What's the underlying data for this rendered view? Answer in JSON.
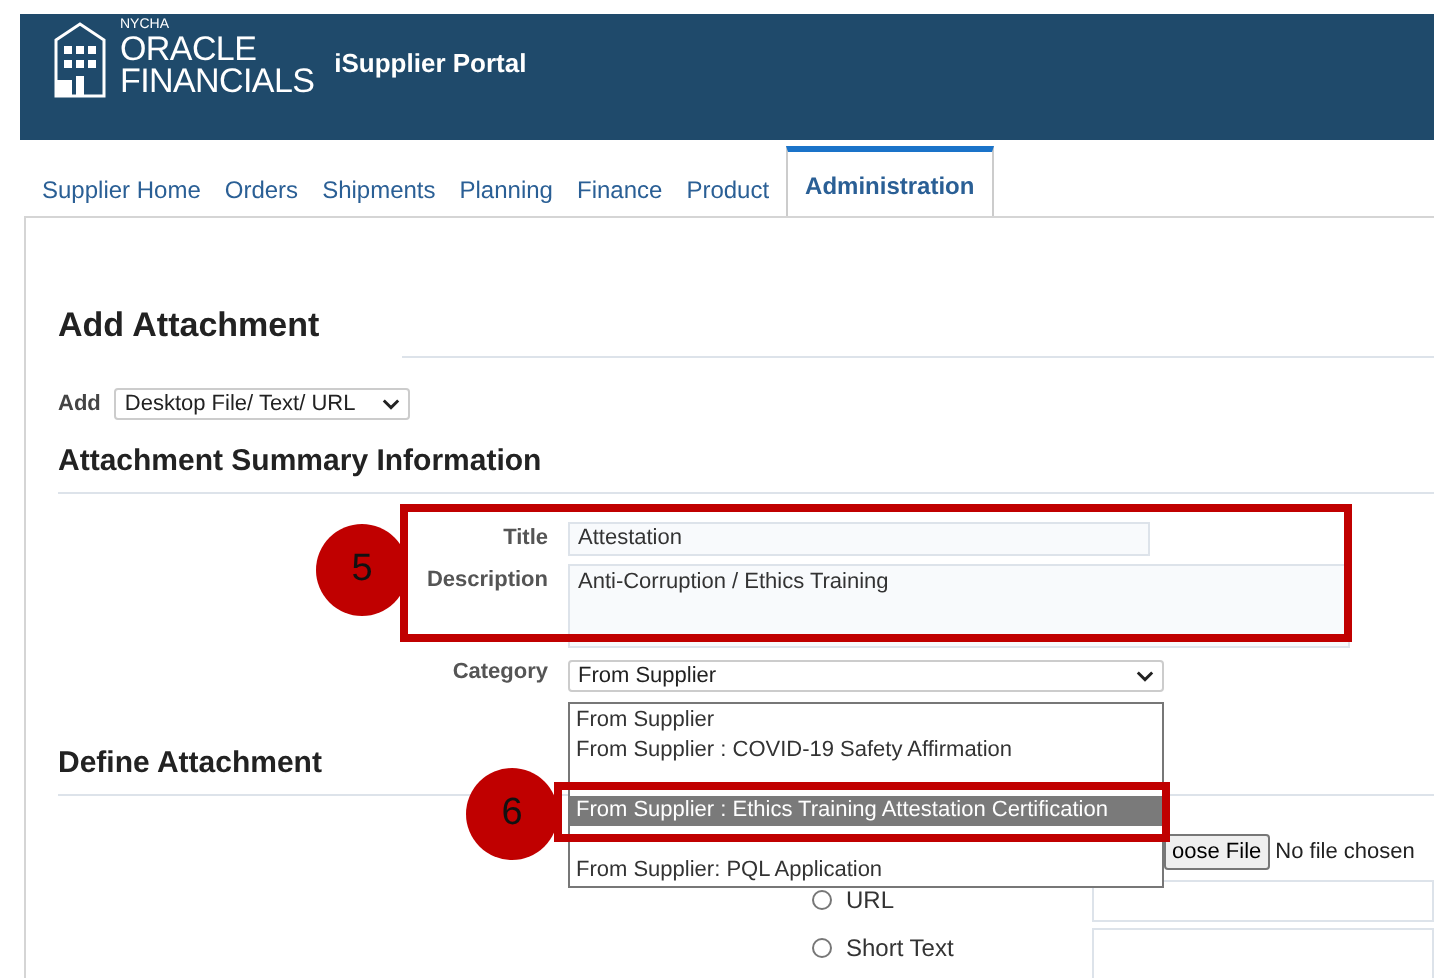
{
  "header": {
    "logo": {
      "agency": "NYCHA",
      "line1": "ORACLE",
      "line2": "FINANCIALS"
    },
    "title": "iSupplier Portal"
  },
  "tabs": [
    {
      "label": "Supplier Home",
      "selected": false
    },
    {
      "label": "Orders",
      "selected": false
    },
    {
      "label": "Shipments",
      "selected": false
    },
    {
      "label": "Planning",
      "selected": false
    },
    {
      "label": "Finance",
      "selected": false
    },
    {
      "label": "Product",
      "selected": false
    },
    {
      "label": "Administration",
      "selected": true
    }
  ],
  "page_title": "Add Attachment",
  "add": {
    "label": "Add",
    "value": "Desktop File/ Text/ URL"
  },
  "summary": {
    "heading": "Attachment Summary Information",
    "title": {
      "label": "Title",
      "value": "Attestation"
    },
    "description": {
      "label": "Description",
      "value": "Anti-Corruption / Ethics Training"
    },
    "category": {
      "label": "Category",
      "value": "From Supplier"
    }
  },
  "category_options": [
    {
      "label": "From Supplier",
      "selected": false
    },
    {
      "label": "From Supplier : COVID-19 Safety Affirmation",
      "selected": false
    },
    {
      "label": "From Supplier : Ethics Training Attestation Certification",
      "selected": true
    },
    {
      "label": "From Supplier: PQL Application",
      "selected": false
    }
  ],
  "define": {
    "heading": "Define Attachment",
    "file_button": "oose File",
    "file_status": "No file chosen",
    "options": [
      {
        "label": "URL",
        "selected": false
      },
      {
        "label": "Short Text",
        "selected": false
      }
    ]
  },
  "callouts": [
    {
      "number": "5"
    },
    {
      "number": "6"
    }
  ]
}
